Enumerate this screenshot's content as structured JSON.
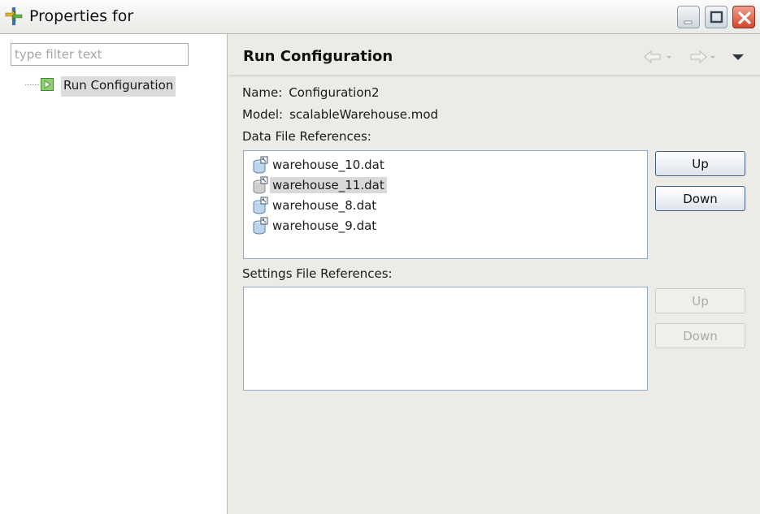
{
  "window": {
    "title": "Properties for",
    "minimize_icon": "minimize-icon",
    "maximize_icon": "maximize-icon",
    "close_icon": "close-icon"
  },
  "sidebar": {
    "filter_placeholder": "type filter text",
    "filter_value": "",
    "tree": [
      {
        "label": "Run Configuration",
        "icon": "run-configuration-icon",
        "selected": true
      }
    ]
  },
  "page": {
    "title": "Run Configuration",
    "nav_back_icon": "back-arrow-icon",
    "nav_forward_icon": "forward-arrow-icon",
    "view_menu_icon": "view-menu-icon",
    "name_label": "Name:",
    "name_value": "Configuration2",
    "model_label": "Model:",
    "model_value": "scalableWarehouse.mod",
    "data_refs_label": "Data File References:",
    "data_files": [
      {
        "name": "warehouse_10.dat",
        "selected": false
      },
      {
        "name": "warehouse_11.dat",
        "selected": true
      },
      {
        "name": "warehouse_8.dat",
        "selected": false
      },
      {
        "name": "warehouse_9.dat",
        "selected": false
      }
    ],
    "data_up_label": "Up",
    "data_down_label": "Down",
    "settings_refs_label": "Settings File References:",
    "settings_files": [],
    "settings_up_label": "Up",
    "settings_down_label": "Down"
  },
  "colors": {
    "selection": "#d9d9d9",
    "list_border": "#8faac6",
    "close_button": "#d3462c"
  }
}
